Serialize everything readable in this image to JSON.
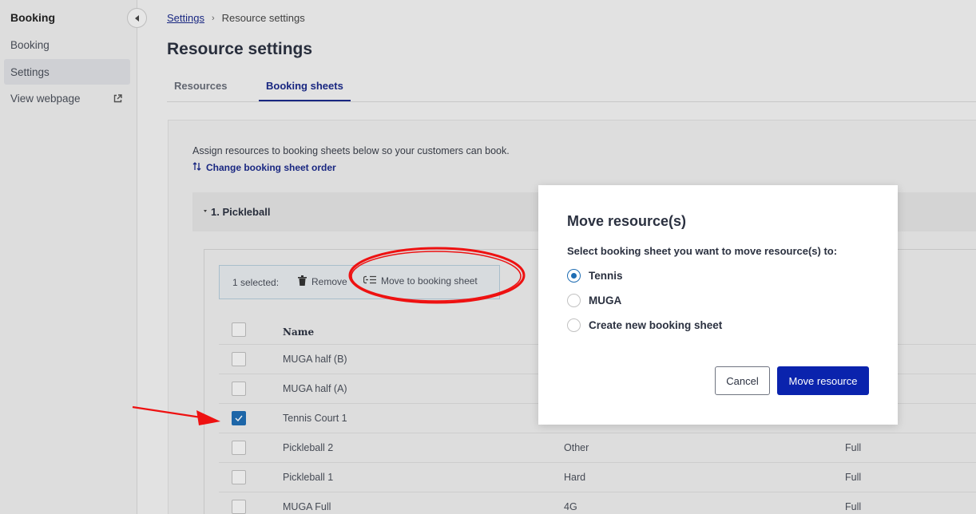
{
  "sidebar": {
    "title": "Booking",
    "items": [
      {
        "label": "Booking"
      },
      {
        "label": "Settings"
      },
      {
        "label": "View webpage"
      }
    ]
  },
  "breadcrumb": {
    "link": "Settings",
    "separator": "›",
    "current": "Resource settings"
  },
  "page": {
    "title": "Resource settings",
    "tabs": [
      {
        "label": "Resources"
      },
      {
        "label": "Booking sheets"
      }
    ]
  },
  "panel": {
    "assign_text": "Assign resources to booking sheets below so your customers can book.",
    "order_link": "Change booking sheet order",
    "sheet_title": "1. Pickleball",
    "selection": {
      "count": "1 selected:",
      "remove": "Remove",
      "move": "Move to booking sheet"
    },
    "table": {
      "header_name": "Name",
      "rows": [
        {
          "name": "MUGA half (B)",
          "surface": "",
          "availability": ""
        },
        {
          "name": "MUGA half (A)",
          "surface": "",
          "availability": ""
        },
        {
          "name": "Tennis Court 1",
          "surface": "",
          "availability": ""
        },
        {
          "name": "Pickleball 2",
          "surface": "Other",
          "availability": "Full"
        },
        {
          "name": "Pickleball 1",
          "surface": "Hard",
          "availability": "Full"
        },
        {
          "name": "MUGA Full",
          "surface": "4G",
          "availability": "Full"
        }
      ]
    }
  },
  "dialog": {
    "title": "Move resource(s)",
    "subtitle": "Select booking sheet you want to move resource(s) to:",
    "options": [
      {
        "label": "Tennis"
      },
      {
        "label": "MUGA"
      },
      {
        "label": "Create new booking sheet"
      }
    ],
    "selected_option": "Tennis",
    "cancel": "Cancel",
    "confirm": "Move resource"
  },
  "colors": {
    "accent": "#1b2a8a",
    "primary_button": "#0a23ad",
    "checkbox_checked": "#1f6db3",
    "annotation": "#ee1111"
  }
}
